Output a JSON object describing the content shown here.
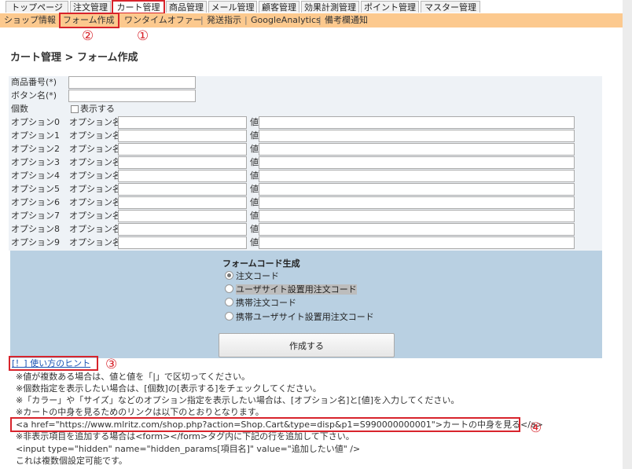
{
  "tabs": [
    "トップページ",
    "注文管理",
    "カート管理",
    "商品管理",
    "メール管理",
    "顧客管理",
    "効果計測管理",
    "ポイント管理",
    "マスター管理"
  ],
  "subnav": {
    "items": [
      "ショップ情報",
      "フォーム作成",
      "ワンタイムオファー",
      "発送指示",
      "GoogleAnalytics",
      "備考欄通知"
    ],
    "separator": "|"
  },
  "markers": [
    "①",
    "②",
    "③",
    "④"
  ],
  "breadcrumb": "カート管理 > フォーム作成",
  "form": {
    "product_no_label": "商品番号(*)",
    "button_name_label": "ボタン名(*)",
    "quantity_label": "個数",
    "show_label": "表示する",
    "option_name_label": "オプション名",
    "value_label": "値",
    "options": [
      "オプション0",
      "オプション1",
      "オプション2",
      "オプション3",
      "オプション4",
      "オプション5",
      "オプション6",
      "オプション7",
      "オプション8",
      "オプション9"
    ]
  },
  "code_gen": {
    "title": "フォームコード生成",
    "radios": [
      "注文コード",
      "ユーザサイト設置用注文コード",
      "携帯注文コード",
      "携帯ユーザサイト設置用注文コード"
    ],
    "selected_index": 0,
    "button": "作成する"
  },
  "hint_link": "[！] 使い方のヒント",
  "notes": [
    "※値が複数ある場合は、値と値を「|」で区切ってください。",
    "※個数指定を表示したい場合は、[個数]の[表示する]をチェックしてください。",
    "※「カラー」や「サイズ」などのオプション指定を表示したい場合は、[オプション名]と[値]を入力してください。",
    "※カートの中身を見るためのリンクは以下のとおりとなります。",
    "<a href=\"https://www.mlritz.com/shop.php?action=Shop.Cart&type=disp&p1=S990000000001\">カートの中身を見る</a>",
    "※非表示項目を追加する場合は<form></form>タグ内に下記の行を追加して下さい。",
    "<input type=\"hidden\" name=\"hidden_params[項目名]\" value=\"追加したい値\" />",
    "これは複数個設定可能です。"
  ],
  "colors": {
    "subnav_bg": "#fcc98e",
    "annotation_red": "#d8242c",
    "code_panel_bg": "#b9d0e2",
    "link": "#1a53b5"
  }
}
